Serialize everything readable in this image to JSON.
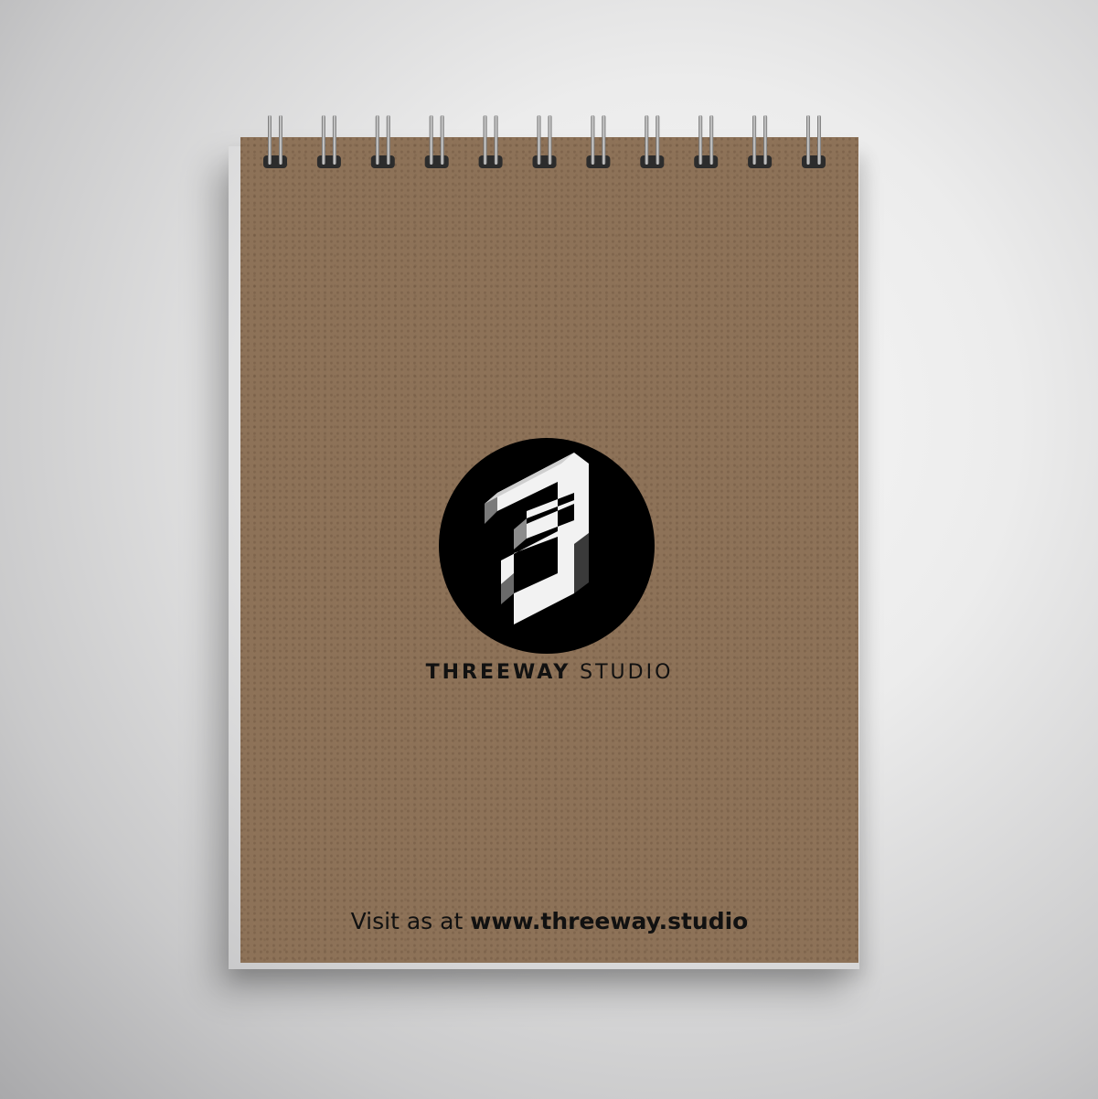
{
  "brand": {
    "name_bold": "THREEWAY",
    "name_light": "STUDIO",
    "logo_icon": "threeway-3-logo-icon"
  },
  "footer": {
    "prefix": "Visit as at ",
    "url": "www.threeway.studio"
  },
  "colors": {
    "kraft": "#8d7258",
    "logo_circle": "#000000",
    "logo_face": "#ffffff",
    "text": "#111111",
    "ring_metal": "#9a9a9a"
  }
}
